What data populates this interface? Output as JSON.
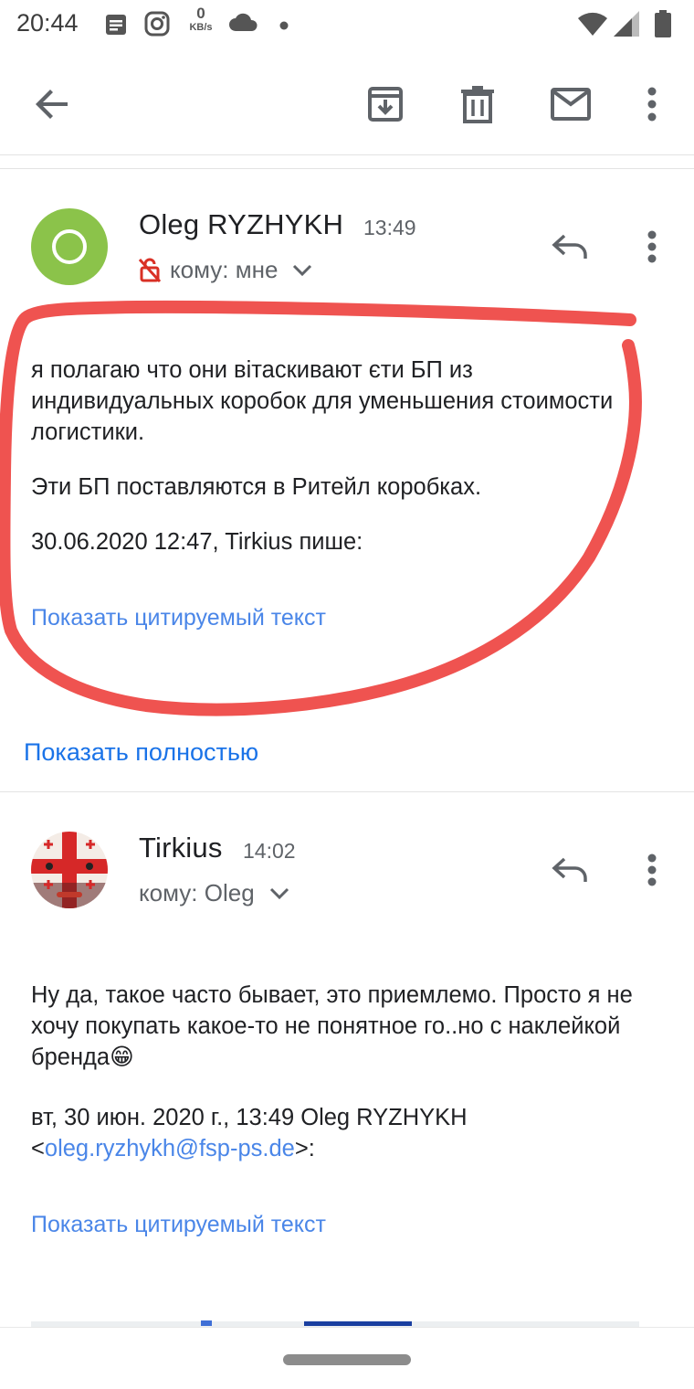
{
  "status_bar": {
    "time": "20:44",
    "net_speed_value": "0",
    "net_speed_unit": "KB/s",
    "icons": [
      "message-icon",
      "instagram-icon",
      "cloud-icon",
      "dot-icon",
      "wifi-icon",
      "signal-icon",
      "battery-icon"
    ]
  },
  "toolbar": {
    "icons": [
      "back-arrow-icon",
      "archive-icon",
      "delete-icon",
      "mail-icon",
      "more-vert-icon"
    ]
  },
  "messages": [
    {
      "sender": "Oleg RYZHYKH",
      "time": "13:49",
      "to_line": "кому: мне",
      "avatar_color": "#8bc34a",
      "body": [
        "я полагаю что они вітаскивают єти БП из индивидуальных коробок для уменьшения стоимости логистики.",
        "Эти БП поставляются в Ритейл коробках.",
        "30.06.2020 12:47, Tirkius пише:"
      ],
      "show_quoted": "Показать цитируемый текст",
      "show_full": "Показать полностью"
    },
    {
      "sender": "Tirkius",
      "time": "14:02",
      "to_line": "кому: Oleg",
      "body": [
        "Ну да, такое часто бывает, это приемлемо. Просто я не хочу покупать какое-то не понятное го..но с наклейкой бренда😁"
      ],
      "quote_header_prefix": "вт, 30 июн. 2020 г., 13:49 Oleg RYZHYKH",
      "quote_lt": "<",
      "quote_email": "oleg.ryzhykh@fsp-ps.de",
      "quote_gt_colon": ">:",
      "show_quoted": "Показать цитируемый текст"
    }
  ],
  "colors": {
    "link": "#4a86e8",
    "highlight_stroke": "#ef5350"
  }
}
